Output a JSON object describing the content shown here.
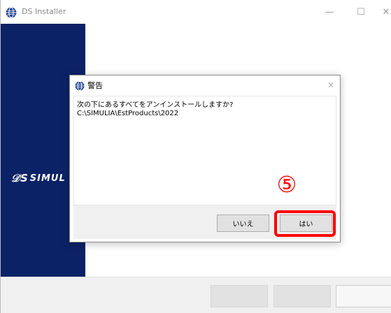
{
  "window": {
    "title": "DS Installer",
    "controls": {
      "minimize": "—",
      "maximize": "☐",
      "close": "✕"
    }
  },
  "brand": {
    "mark": "𝒟S",
    "name": "SIMUL"
  },
  "dialog": {
    "title": "警告",
    "message_line1": "次の下にあるすべてをアンインストールしますか?",
    "message_line2": "C:\\SIMULIA\\EstProducts\\2022",
    "close_glyph": "✕",
    "no_label": "いいえ",
    "yes_label": "はい"
  },
  "annotation": {
    "step": "⑤",
    "color": "#ff0000"
  },
  "colors": {
    "brand_panel": "#0c2266",
    "footer": "#f0f0f0"
  },
  "icons": {
    "app_icon": "globe-icon",
    "dialog_icon": "globe-icon"
  }
}
